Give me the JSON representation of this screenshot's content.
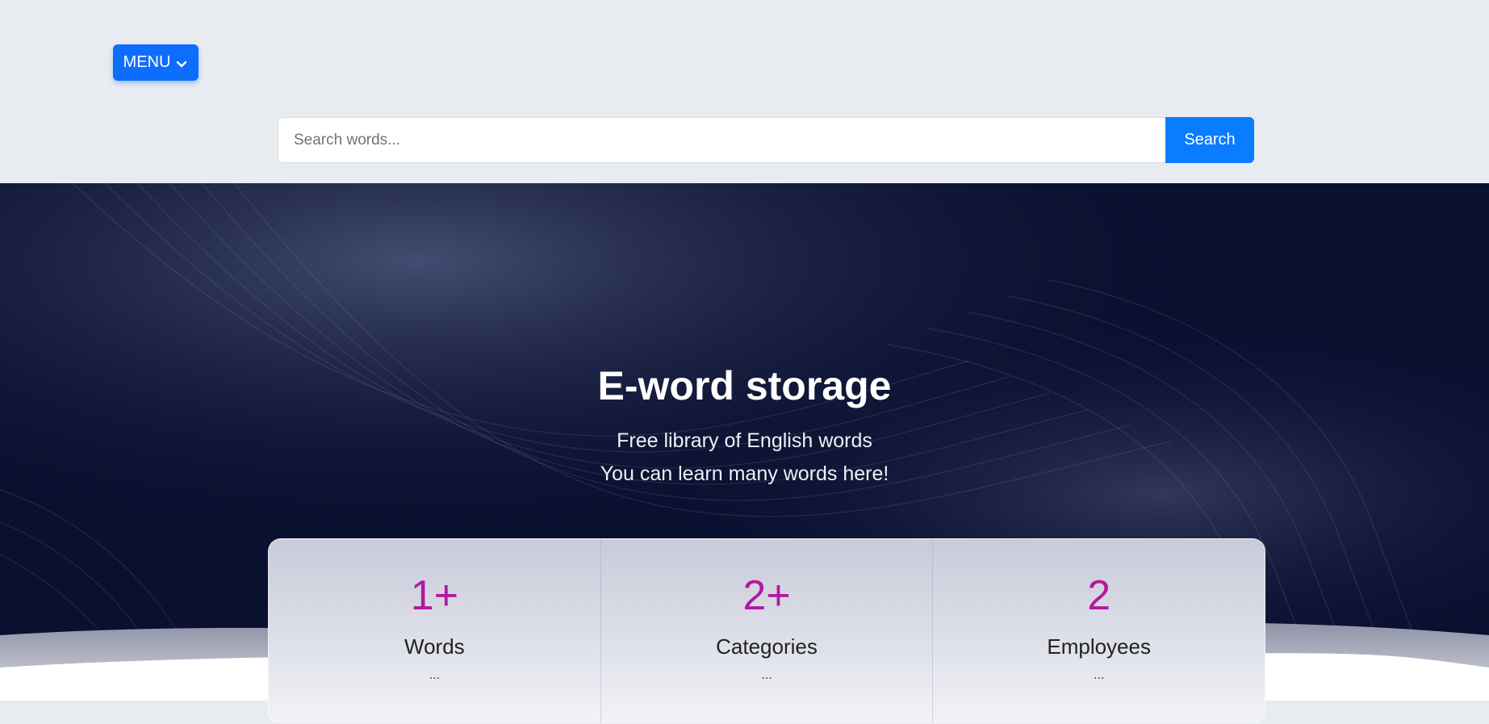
{
  "header": {
    "menu_label": "MENU",
    "search": {
      "placeholder": "Search words...",
      "value": "",
      "button_label": "Search"
    }
  },
  "hero": {
    "title": "E-word storage",
    "subtitle_line1": "Free library of English words",
    "subtitle_line2": "You can learn many words here!"
  },
  "stats": [
    {
      "value": "1+",
      "label": "Words",
      "desc": "..."
    },
    {
      "value": "2+",
      "label": "Categories",
      "desc": "..."
    },
    {
      "value": "2",
      "label": "Employees",
      "desc": "..."
    }
  ],
  "colors": {
    "primary": "#0d6efd",
    "search_button": "#0a7cff",
    "hero_bg": "#0a1030",
    "stat_number": "#b5179e",
    "topbar_bg": "#e8ebef"
  },
  "icons": {
    "menu_chevron": "chevron-down-icon"
  }
}
